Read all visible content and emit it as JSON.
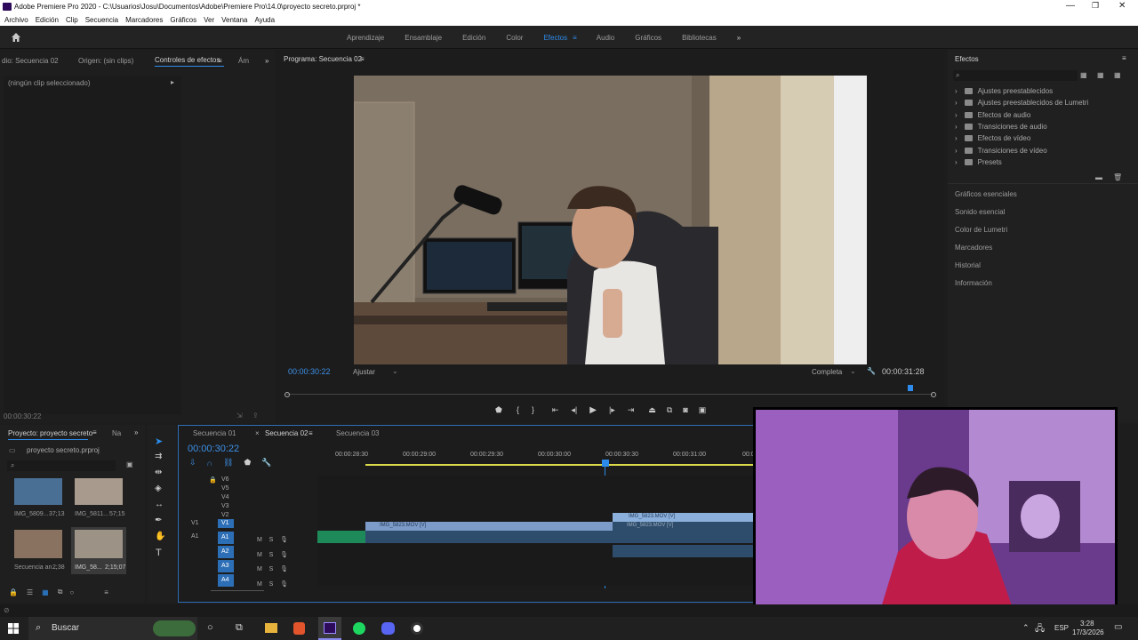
{
  "window": {
    "title": "Adobe Premiere Pro 2020 - C:\\Usuarios\\Josu\\Documentos\\Adobe\\Premiere Pro\\14.0\\proyecto secreto.prproj *"
  },
  "menu": [
    "Archivo",
    "Edición",
    "Clip",
    "Secuencia",
    "Marcadores",
    "Gráficos",
    "Ver",
    "Ventana",
    "Ayuda"
  ],
  "workspaces": {
    "items": [
      "Aprendizaje",
      "Ensamblaje",
      "Edición",
      "Color",
      "Efectos",
      "Audio",
      "Gráficos",
      "Bibliotecas"
    ],
    "active": "Efectos"
  },
  "left_panel": {
    "tabs": [
      "dio: Secuencia 02",
      "Origen: (sin clips)",
      "Controles de efectos",
      "Ám"
    ],
    "active": "Controles de efectos",
    "no_clip": "(ningún clip seleccionado)",
    "timecode": "00:00:30:22"
  },
  "program": {
    "tab": "Programa: Secuencia 02",
    "timecode_left": "00:00:30:22",
    "fit": "Ajustar",
    "quality": "Completa",
    "timecode_right": "00:00:31:28"
  },
  "effects": {
    "title": "Efectos",
    "items": [
      "Ajustes preestablecidos",
      "Ajustes preestablecidos de Lumetri",
      "Efectos de audio",
      "Transiciones de audio",
      "Efectos de vídeo",
      "Transiciones de vídeo",
      "Presets"
    ],
    "sections": [
      "Gráficos esenciales",
      "Sonido esencial",
      "Color de Lumetri",
      "Marcadores",
      "Historial",
      "Información"
    ]
  },
  "project": {
    "tabs": [
      "Proyecto: proyecto secreto",
      "Na"
    ],
    "file": "proyecto secreto.prproj",
    "clips": [
      {
        "name": "IMG_5809...",
        "dur": "37;13"
      },
      {
        "name": "IMG_5811...",
        "dur": "57;15"
      },
      {
        "name": "Secuencia an...",
        "dur": "2;38"
      },
      {
        "name": "IMG_58...",
        "dur": "2;15;07"
      }
    ]
  },
  "timeline": {
    "tabs": [
      "Secuencia 01",
      "Secuencia 02",
      "Secuencia 03"
    ],
    "active": "Secuencia 02",
    "timecode": "00:00:30:22",
    "ruler": [
      "00:00:28:30",
      "00:00:29:00",
      "00:00:29:30",
      "00:00:30:00",
      "00:00:30:30",
      "00:00:31:00",
      "00:0"
    ],
    "video_tracks": [
      "V6",
      "V5",
      "V4",
      "V3",
      "V2",
      "V1"
    ],
    "audio_tracks": [
      "A1",
      "A2",
      "A3",
      "A4"
    ],
    "src_v": "V1",
    "src_a": "A1",
    "clip_labels": [
      "IMG_5823.MOV [V]",
      "IMG_5823.MOV [V]",
      "IMG_5823.MOV [V]"
    ]
  },
  "taskbar": {
    "search": "Buscar",
    "lang": "ESP",
    "time": "3:28",
    "date": "17/3/2026"
  },
  "colors": {
    "accent": "#2d8ceb",
    "timecode": "#3d8fe6"
  }
}
